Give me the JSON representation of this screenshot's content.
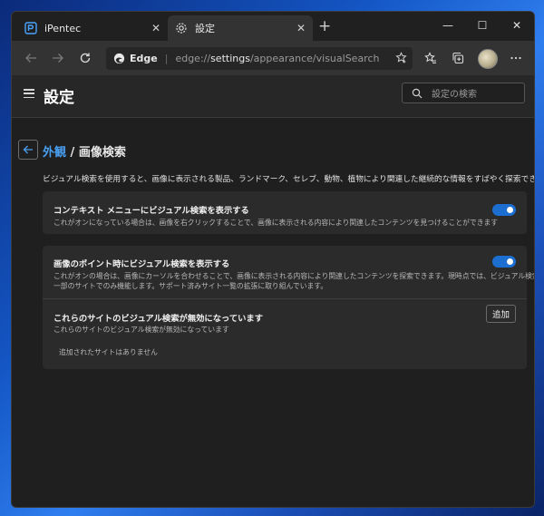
{
  "browser": {
    "tabs": [
      {
        "label": "iPentec",
        "close": "✕",
        "active": false
      },
      {
        "label": "設定",
        "close": "✕",
        "active": true
      }
    ],
    "new_tab": "+",
    "window_controls": {
      "minimize": "—",
      "maximize": "☐",
      "close": "✕"
    },
    "address": {
      "browser_name": "Edge",
      "url_prefix": "edge://",
      "url_strong": "settings",
      "url_rest": "/appearance/visualSearch"
    }
  },
  "settings": {
    "title": "設定",
    "search_placeholder": "設定の検索",
    "breadcrumb": {
      "parent": "外観",
      "separator": "/",
      "current": "画像検索"
    },
    "description": "ビジュアル検索を使用すると、画像に表示される製品、ランドマーク、セレブ、動物、植物により関連した継続的な情報をすばやく探索できます",
    "context_menu": {
      "title": "コンテキスト メニューにビジュアル検索を表示する",
      "description": "これがオンになっている場合は、画像を右クリックすることで、画像に表示される内容により関連したコンテンツを見つけることができます",
      "enabled": true
    },
    "hover": {
      "title": "画像のポイント時にビジュアル検索を表示する",
      "description_line1": "これがオンの場合は、画像にカーソルを合わせることで、画像に表示される内容により関連したコンテンツを探索できます。現時点では、ビジュアル検索は",
      "description_line2": "一部のサイトでのみ機能します。サポート済みサイト一覧の拡張に取り組んでいます。",
      "enabled": true
    },
    "disabled_sites": {
      "title": "これらのサイトのビジュアル検索が無効になっています",
      "description": "これらのサイトのビジュアル検索が無効になっています",
      "add_button": "追加",
      "empty_message": "追加されたサイトはありません"
    }
  },
  "colors": {
    "accent": "#4a9ff0",
    "toggle_on": "#1c6fd1",
    "page_bg": "#1f1f1f",
    "card_bg": "#2b2b2b"
  }
}
